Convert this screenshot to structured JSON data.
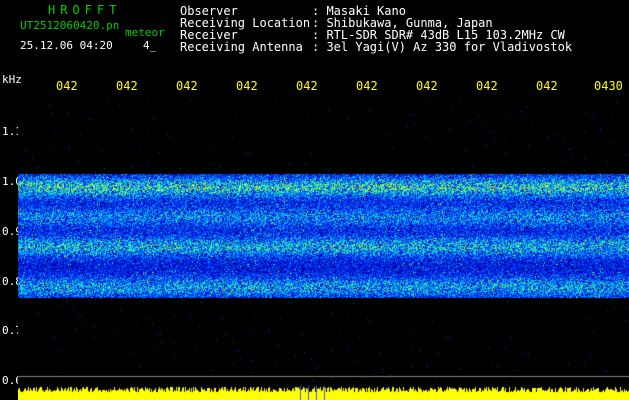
{
  "header": {
    "logo": "HROFFT",
    "file_name": "UT2512060420.pn",
    "tag": "meteor",
    "datetime": "25.12.06 04:20",
    "marker": "4_"
  },
  "metadata": {
    "rows": [
      {
        "label": "Observer",
        "value": ": Masaki Kano"
      },
      {
        "label": "Receiving Location",
        "value": ": Shibukawa, Gunma, Japan"
      },
      {
        "label": "Receiver",
        "value": ": RTL-SDR SDR# 43dB L15 103.2MHz CW"
      },
      {
        "label": "Receiving Antenna",
        "value": ": 3el Yagi(V) Az 330 for Vladivostok"
      }
    ]
  },
  "colors": {
    "background": "#000000",
    "title_green": "#00d000",
    "time_tick_yellow": "#ffff00",
    "activity_bar_yellow": "#ffff00",
    "grid_gray": "#808080"
  },
  "chart_data": {
    "type": "heatmap",
    "title": "",
    "ylabel": "kHz",
    "yunit": "kHz",
    "yticks": [
      "1.1",
      "1.0",
      "0.9",
      "0.8",
      "0.7",
      "0.6"
    ],
    "ylim": [
      0.6,
      1.15
    ],
    "time_labels": [
      "042",
      "042",
      "042",
      "042",
      "042",
      "042",
      "042",
      "042",
      "042",
      "0430"
    ],
    "signal_band_khz": [
      0.78,
      1.01
    ],
    "strong_bands_khz": [
      {
        "center": 0.985,
        "intensity": 1.0
      },
      {
        "center": 0.875,
        "intensity": 0.8
      },
      {
        "center": 0.8,
        "intensity": 0.7
      },
      {
        "center": 0.93,
        "intensity": 0.55
      }
    ],
    "colormap": [
      "#000010",
      "#0000c0",
      "#0040ff",
      "#00c0ff",
      "#40ff80",
      "#ffff00",
      "#ff4000"
    ],
    "activity_bar": {
      "color": "#ffff00",
      "level_fraction": 0.5
    }
  }
}
